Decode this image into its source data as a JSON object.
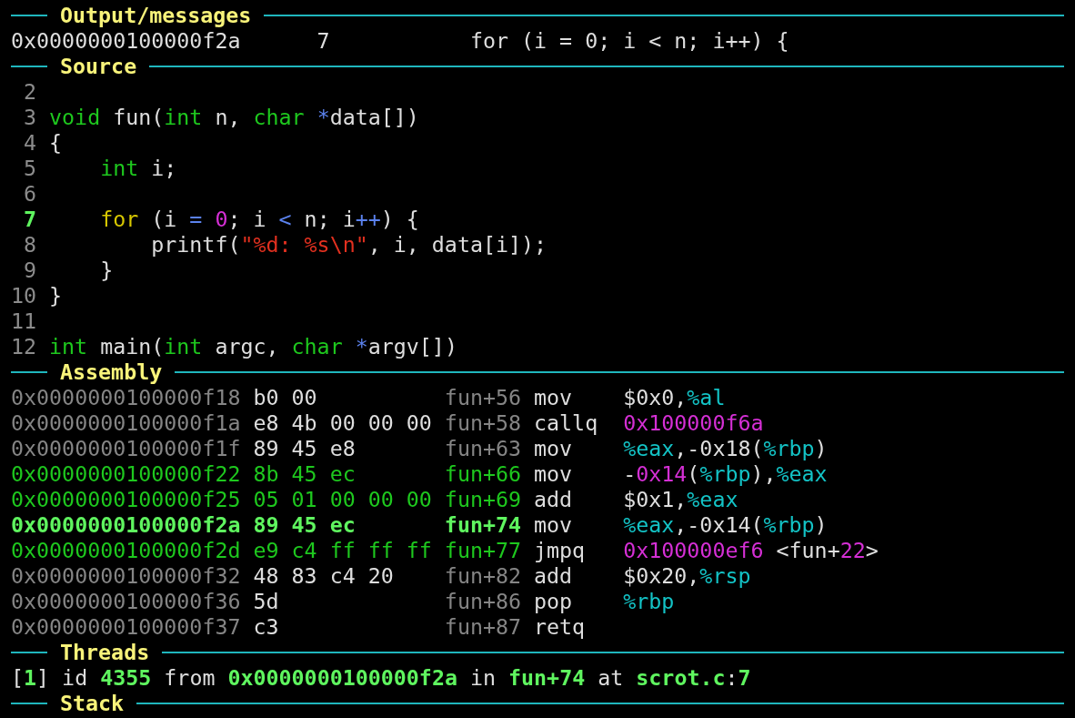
{
  "output": {
    "title": "Output/messages",
    "line": "0x0000000100000f2a      7           for (i = 0; i < n; i++) {"
  },
  "source": {
    "title": "Source",
    "lines": [
      {
        "number": "2",
        "current": false
      },
      {
        "number": "3",
        "current": false,
        "tokens": [
          {
            "text": "void",
            "kind": "type"
          },
          {
            "text": " fun(",
            "kind": "plain"
          },
          {
            "text": "int",
            "kind": "type"
          },
          {
            "text": " n, ",
            "kind": "plain"
          },
          {
            "text": "char",
            "kind": "type"
          },
          {
            "text": " *",
            "kind": "operator"
          },
          {
            "text": "data[])",
            "kind": "plain"
          }
        ]
      },
      {
        "number": "4",
        "current": false,
        "tokens": [
          {
            "text": "{",
            "kind": "plain"
          }
        ]
      },
      {
        "number": "5",
        "current": false,
        "tokens": [
          {
            "text": "    int",
            "kind": "type"
          },
          {
            "text": " i;",
            "kind": "plain"
          }
        ]
      },
      {
        "number": "6",
        "current": false
      },
      {
        "number": "7",
        "current": true,
        "tokens": [
          {
            "text": "    for",
            "kind": "keyword"
          },
          {
            "text": " (i ",
            "kind": "plain"
          },
          {
            "text": "=",
            "kind": "operator"
          },
          {
            "text": " 0",
            "kind": "number"
          },
          {
            "text": "; i ",
            "kind": "plain"
          },
          {
            "text": "<",
            "kind": "operator"
          },
          {
            "text": " n; i",
            "kind": "plain"
          },
          {
            "text": "++",
            "kind": "operator"
          },
          {
            "text": ") {",
            "kind": "plain"
          }
        ]
      },
      {
        "number": "8",
        "current": false,
        "tokens": [
          {
            "text": "        printf(",
            "kind": "plain"
          },
          {
            "text": "\"%d: %s\\n\"",
            "kind": "string"
          },
          {
            "text": ", i, data[i]);",
            "kind": "plain"
          }
        ]
      },
      {
        "number": "9",
        "current": false,
        "tokens": [
          {
            "text": "    }",
            "kind": "plain"
          }
        ]
      },
      {
        "number": "10",
        "current": false,
        "tokens": [
          {
            "text": "}",
            "kind": "plain"
          }
        ]
      },
      {
        "number": "11",
        "current": false
      },
      {
        "number": "12",
        "current": false,
        "tokens": [
          {
            "text": "int",
            "kind": "type"
          },
          {
            "text": " main(",
            "kind": "plain"
          },
          {
            "text": "int",
            "kind": "type"
          },
          {
            "text": " argc, ",
            "kind": "plain"
          },
          {
            "text": "char",
            "kind": "type"
          },
          {
            "text": " *",
            "kind": "operator"
          },
          {
            "text": "argv[])",
            "kind": "plain"
          }
        ]
      }
    ]
  },
  "assembly": {
    "title": "Assembly",
    "rows": [
      {
        "address": "0x0000000100000f18",
        "bytes": "b0 00",
        "offset": "fun+56",
        "mnemonic": "mov",
        "in_line": false,
        "current": false,
        "operands": [
          {
            "text": "$0x0,",
            "kind": "plain"
          },
          {
            "text": "%al",
            "kind": "register"
          }
        ]
      },
      {
        "address": "0x0000000100000f1a",
        "bytes": "e8 4b 00 00 00",
        "offset": "fun+58",
        "mnemonic": "callq",
        "in_line": false,
        "current": false,
        "operands": [
          {
            "text": "0x100000f6a",
            "kind": "number"
          }
        ]
      },
      {
        "address": "0x0000000100000f1f",
        "bytes": "89 45 e8",
        "offset": "fun+63",
        "mnemonic": "mov",
        "in_line": false,
        "current": false,
        "operands": [
          {
            "text": "%eax",
            "kind": "register"
          },
          {
            "text": ",-0x18(",
            "kind": "plain"
          },
          {
            "text": "%rbp",
            "kind": "register"
          },
          {
            "text": ")",
            "kind": "plain"
          }
        ]
      },
      {
        "address": "0x0000000100000f22",
        "bytes": "8b 45 ec",
        "offset": "fun+66",
        "mnemonic": "mov",
        "in_line": true,
        "current": false,
        "operands": [
          {
            "text": "-",
            "kind": "plain"
          },
          {
            "text": "0x14",
            "kind": "number"
          },
          {
            "text": "(",
            "kind": "plain"
          },
          {
            "text": "%rbp",
            "kind": "register"
          },
          {
            "text": "),",
            "kind": "plain"
          },
          {
            "text": "%eax",
            "kind": "register"
          }
        ]
      },
      {
        "address": "0x0000000100000f25",
        "bytes": "05 01 00 00 00",
        "offset": "fun+69",
        "mnemonic": "add",
        "in_line": true,
        "current": false,
        "operands": [
          {
            "text": "$0x1,",
            "kind": "plain"
          },
          {
            "text": "%eax",
            "kind": "register"
          }
        ]
      },
      {
        "address": "0x0000000100000f2a",
        "bytes": "89 45 ec",
        "offset": "fun+74",
        "mnemonic": "mov",
        "in_line": true,
        "current": true,
        "operands": [
          {
            "text": "%eax",
            "kind": "register"
          },
          {
            "text": ",-0x14(",
            "kind": "plain"
          },
          {
            "text": "%rbp",
            "kind": "register"
          },
          {
            "text": ")",
            "kind": "plain"
          }
        ]
      },
      {
        "address": "0x0000000100000f2d",
        "bytes": "e9 c4 ff ff ff",
        "offset": "fun+77",
        "mnemonic": "jmpq",
        "in_line": true,
        "current": false,
        "operands": [
          {
            "text": "0x100000ef6",
            "kind": "number"
          },
          {
            "text": " <fun+",
            "kind": "plain"
          },
          {
            "text": "22",
            "kind": "number"
          },
          {
            "text": ">",
            "kind": "plain"
          }
        ]
      },
      {
        "address": "0x0000000100000f32",
        "bytes": "48 83 c4 20",
        "offset": "fun+82",
        "mnemonic": "add",
        "in_line": false,
        "current": false,
        "operands": [
          {
            "text": "$0x20,",
            "kind": "plain"
          },
          {
            "text": "%rsp",
            "kind": "register"
          }
        ]
      },
      {
        "address": "0x0000000100000f36",
        "bytes": "5d",
        "offset": "fun+86",
        "mnemonic": "pop",
        "in_line": false,
        "current": false,
        "operands": [
          {
            "text": "%rbp",
            "kind": "register"
          }
        ]
      },
      {
        "address": "0x0000000100000f37",
        "bytes": "c3",
        "offset": "fun+87",
        "mnemonic": "retq",
        "in_line": false,
        "current": false
      }
    ]
  },
  "threads": {
    "title": "Threads",
    "tokens": [
      {
        "text": "[",
        "kind": "plain"
      },
      {
        "text": "1",
        "kind": "highlight"
      },
      {
        "text": "] id ",
        "kind": "plain"
      },
      {
        "text": "4355",
        "kind": "highlight"
      },
      {
        "text": " from ",
        "kind": "plain"
      },
      {
        "text": "0x0000000100000f2a",
        "kind": "highlight"
      },
      {
        "text": " in ",
        "kind": "plain"
      },
      {
        "text": "fun+74",
        "kind": "highlight"
      },
      {
        "text": " at ",
        "kind": "plain"
      },
      {
        "text": "scrot.c",
        "kind": "highlight"
      },
      {
        "text": ":",
        "kind": "plain"
      },
      {
        "text": "7",
        "kind": "highlight"
      }
    ]
  },
  "stack": {
    "title": "Stack"
  }
}
